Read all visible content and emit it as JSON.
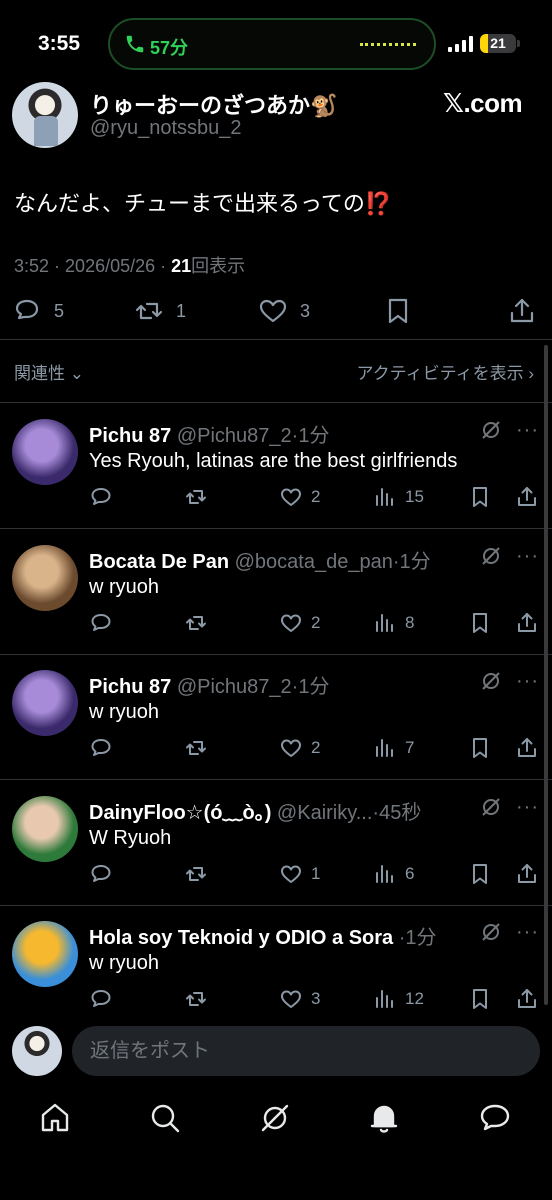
{
  "status_bar": {
    "time": "3:55",
    "call_duration": "57分",
    "battery": "21",
    "battery_level": 0.21,
    "accent_green": "#30d158"
  },
  "tweet": {
    "display_name": "りゅーおーのざつあか🐒",
    "handle": "@ryu_notssbu_2",
    "brand": "𝕏.com",
    "text": "なんだよ、チューまで出来るっての⁉️",
    "time": "3:52",
    "date": "2026/05/26",
    "views": "21",
    "views_label": "回表示",
    "replies": "5",
    "retweets": "1",
    "likes": "3"
  },
  "sort": {
    "left": "関連性",
    "right": "アクティビティを表示"
  },
  "replies": [
    {
      "name": "Pichu 87",
      "handle": "@Pichu87_2",
      "time": "1分",
      "text": "Yes Ryouh, latinas are the best girlfriends",
      "likes": "2",
      "views": "15",
      "avatar_colors": [
        "#3b2a6b",
        "#a78bd8"
      ]
    },
    {
      "name": "Bocata De Pan",
      "handle": "@bocata_de_pan",
      "time": "1分",
      "text": "w ryuoh",
      "likes": "2",
      "views": "8",
      "avatar_colors": [
        "#6b4a2e",
        "#d9b48a"
      ]
    },
    {
      "name": "Pichu 87",
      "handle": "@Pichu87_2",
      "time": "1分",
      "text": "w ryuoh",
      "likes": "2",
      "views": "7",
      "avatar_colors": [
        "#3b2a6b",
        "#a78bd8"
      ]
    },
    {
      "name": "DainyFloo☆(ó﹏ò｡)",
      "handle": "@Kairiky...",
      "time": "45秒",
      "text": "W Ryuoh",
      "likes": "1",
      "views": "6",
      "avatar_colors": [
        "#2e7a3a",
        "#e8c9b0"
      ]
    },
    {
      "name": "Hola soy Teknoid y ODIO a Sora",
      "handle": "",
      "time": "1分",
      "text": "w ryuoh",
      "likes": "3",
      "views": "12",
      "avatar_colors": [
        "#3a8fd8",
        "#f5b82e"
      ]
    }
  ],
  "composer": {
    "placeholder": "返信をポスト"
  },
  "nav": [
    "home-icon",
    "search-icon",
    "grok-icon",
    "notifications-icon",
    "messages-icon"
  ]
}
